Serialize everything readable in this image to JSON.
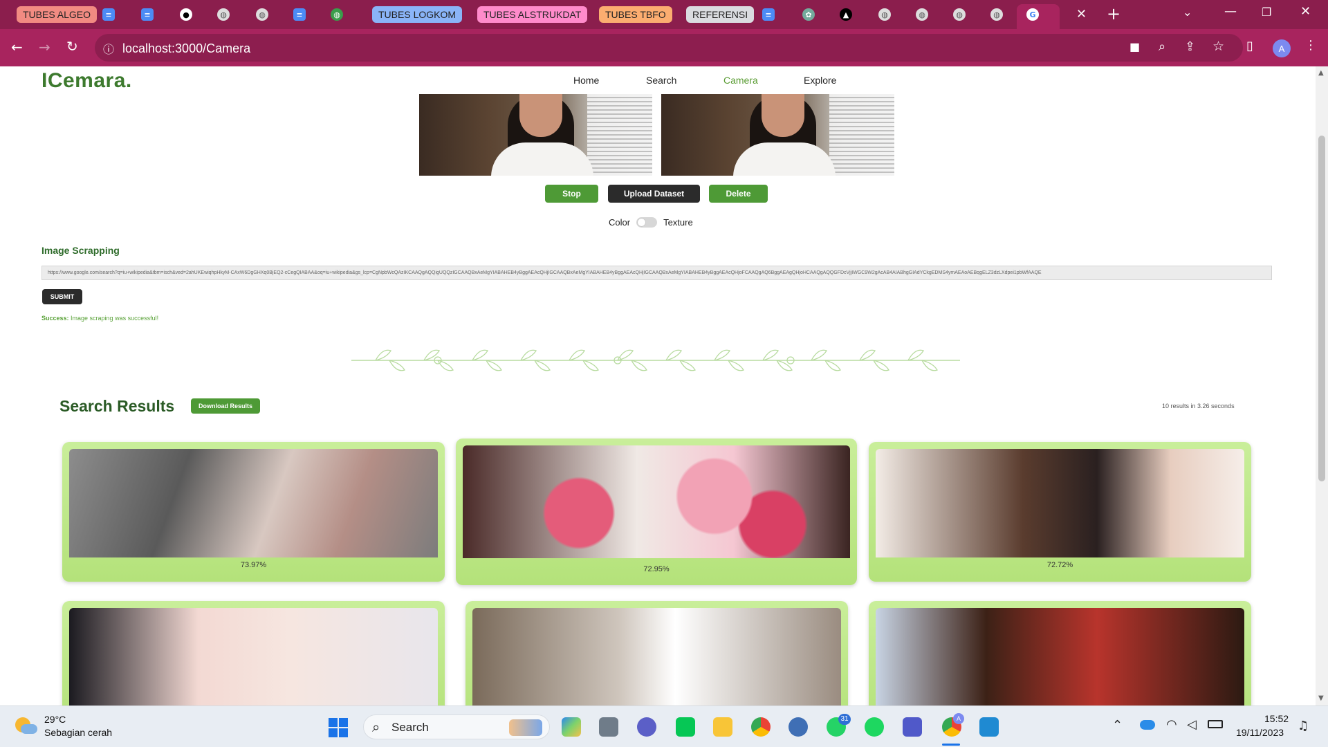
{
  "browser": {
    "tab_groups": [
      "TUBES ALGEO",
      "TUBES LOGKOM",
      "TUBES ALSTRUKDAT",
      "TUBES TBFO",
      "REFERENSI"
    ],
    "url": "localhost:3000/Camera"
  },
  "app": {
    "logo": "ICemara.",
    "nav": [
      "Home",
      "Search",
      "Camera",
      "Explore"
    ],
    "active_nav": "Camera",
    "buttons": {
      "stop": "Stop",
      "upload": "Upload Dataset",
      "delete": "Delete"
    },
    "toggle": {
      "left": "Color",
      "right": "Texture"
    },
    "scrapping": {
      "title": "Image Scrapping",
      "url_value": "https://www.google.com/search?q=iu+wikipedia&tbm=isch&ved=2ahUKEwiqhpHkyM-CAxW6DgGHXq0BjEQ2-cCegQIABAA&oq=iu+wikipedia&gs_lcp=CgNpbWcQAzIKCAAQgAQQigUQQzIGCAAQBxAeMgYIABAHEB4yBggAEAcQHjIGCAAQBxAeMgYIABAHEB4yBggAEAcQHjIGCAAQBxAeMgYIABAHEB4yBggAEAcQHjoFCAAQgAQ6BggAEAgQHjoHCAAQgAQQGFDcVjjIWGC9W2gAcAB4AIABhgGIAdYCkgEDMS4ymAEAoAEBqgELZ3dzLXdpei1pbWfAAQE",
      "submit": "SUBMIT",
      "status_label": "Success:",
      "status_text": " Image scraping was successful!"
    },
    "results": {
      "title": "Search Results",
      "download": "Download Results",
      "meta": "10 results in 3.26 seconds",
      "items": [
        "73.97%",
        "72.95%",
        "72.72%"
      ]
    }
  },
  "taskbar": {
    "temp": "29°C",
    "weather": "Sebagian cerah",
    "search": "Search",
    "time": "15:52",
    "date": "19/11/2023",
    "whatsapp_badge": "31",
    "teams_badge": "A"
  }
}
